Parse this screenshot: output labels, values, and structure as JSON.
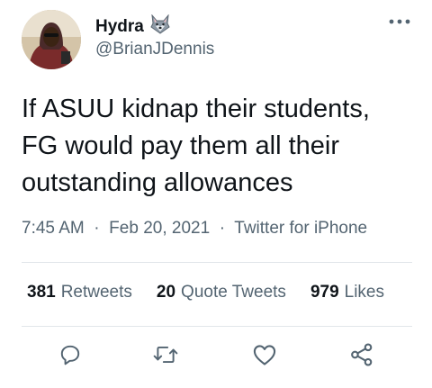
{
  "tweet": {
    "author_name": "Hydra",
    "author_handle": "@BrianJDennis",
    "name_emoji": "🐺",
    "text_lines": [
      "If ASUU kidnap their students,",
      "FG would pay them all their",
      "outstanding allowances"
    ],
    "time": "7:45 AM",
    "date": "Feb 20, 2021",
    "source": "Twitter for iPhone"
  },
  "stats": {
    "retweets_count": "381",
    "retweets_label": "Retweets",
    "quotes_count": "20",
    "quotes_label": "Quote Tweets",
    "likes_count": "979",
    "likes_label": "Likes"
  },
  "icons": {
    "more": "more-icon",
    "reply": "reply-icon",
    "retweet": "retweet-icon",
    "like": "like-icon",
    "share": "share-icon"
  },
  "colors": {
    "icon": "#536471",
    "text": "#0f1419",
    "secondary": "#536471",
    "divider": "#e1e6ea"
  }
}
